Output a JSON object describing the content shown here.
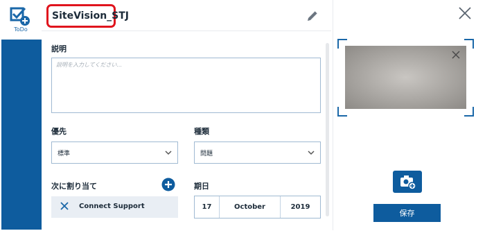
{
  "colors": {
    "accent": "#0e5c9e",
    "highlight": "#e0141d",
    "field_border": "#9fb9d2",
    "assignee_bg": "#e9eef4"
  },
  "sidebar": {
    "app_label": "ToDo",
    "icon": "todo-add-icon"
  },
  "header": {
    "title": "SiteVision_STJ",
    "edit_icon": "pencil-icon"
  },
  "form": {
    "description": {
      "label": "説明",
      "placeholder": "説明を入力してください...",
      "value": ""
    },
    "priority": {
      "label": "優先",
      "value": "標準"
    },
    "category": {
      "label": "種類",
      "value": "問題"
    },
    "assign": {
      "label": "次に割り当て",
      "assignee": "Connect Support"
    },
    "due": {
      "label": "期日",
      "day": "17",
      "month": "October",
      "year": "2019"
    }
  },
  "panel": {
    "close_icon": "close-icon",
    "photo_remove_icon": "close-icon",
    "add_photo_icon": "camera-add-icon",
    "save_label": "保存"
  }
}
